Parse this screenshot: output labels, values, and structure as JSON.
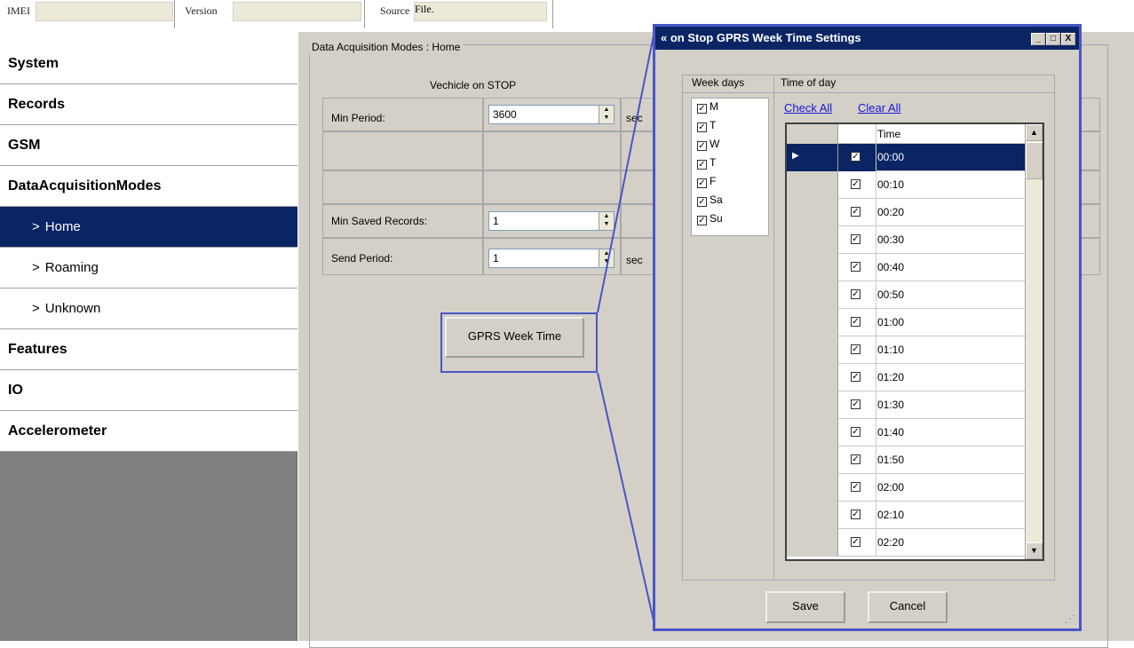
{
  "topbar": {
    "imei_label": "IMEI",
    "version_label": "Version",
    "source_label": "Source",
    "source_value": "File."
  },
  "sidebar": {
    "items": [
      {
        "label": "System",
        "level": "top",
        "active": false
      },
      {
        "label": "Records",
        "level": "top",
        "active": false
      },
      {
        "label": "GSM",
        "level": "top",
        "active": false
      },
      {
        "label": "DataAcquisitionModes",
        "level": "top",
        "active": false
      },
      {
        "label": "Home",
        "level": "sub",
        "active": true
      },
      {
        "label": "Roaming",
        "level": "sub",
        "active": false
      },
      {
        "label": "Unknown",
        "level": "sub",
        "active": false
      },
      {
        "label": "Features",
        "level": "top",
        "active": false
      },
      {
        "label": "IO",
        "level": "top",
        "active": false
      },
      {
        "label": "Accelerometer",
        "level": "top",
        "active": false
      }
    ],
    "chevron": ">"
  },
  "main": {
    "group_title": "Data Acquisition Modes : Home",
    "section_title": "Vechicle on STOP",
    "min_period": {
      "label": "Min Period:",
      "value": "3600",
      "unit": "sec"
    },
    "min_saved_records": {
      "label": "Min Saved Records:",
      "value": "1"
    },
    "send_period": {
      "label": "Send Period:",
      "value": "1",
      "unit": "sec"
    },
    "gprs_button": "GPRS Week Time"
  },
  "dialog": {
    "title": "on Stop GPRS Week Time Settings",
    "title_buttons": [
      "_",
      "□",
      "X"
    ],
    "week_days_header": "Week days",
    "time_of_day_header": "Time of day",
    "check_all": "Check All",
    "clear_all": "Clear All",
    "week_days": [
      {
        "label": "M",
        "checked": true
      },
      {
        "label": "T",
        "checked": true
      },
      {
        "label": "W",
        "checked": true
      },
      {
        "label": "T",
        "checked": true
      },
      {
        "label": "F",
        "checked": true
      },
      {
        "label": "Sa",
        "checked": true
      },
      {
        "label": "Su",
        "checked": true
      }
    ],
    "time_column_header": "Time",
    "times": [
      {
        "time": "00:00",
        "checked": true,
        "selected": true
      },
      {
        "time": "00:10",
        "checked": true,
        "selected": false
      },
      {
        "time": "00:20",
        "checked": true,
        "selected": false
      },
      {
        "time": "00:30",
        "checked": true,
        "selected": false
      },
      {
        "time": "00:40",
        "checked": true,
        "selected": false
      },
      {
        "time": "00:50",
        "checked": true,
        "selected": false
      },
      {
        "time": "01:00",
        "checked": true,
        "selected": false
      },
      {
        "time": "01:10",
        "checked": true,
        "selected": false
      },
      {
        "time": "01:20",
        "checked": true,
        "selected": false
      },
      {
        "time": "01:30",
        "checked": true,
        "selected": false
      },
      {
        "time": "01:40",
        "checked": true,
        "selected": false
      },
      {
        "time": "01:50",
        "checked": true,
        "selected": false
      },
      {
        "time": "02:00",
        "checked": true,
        "selected": false
      },
      {
        "time": "02:10",
        "checked": true,
        "selected": false
      },
      {
        "time": "02:20",
        "checked": true,
        "selected": false
      }
    ],
    "save_label": "Save",
    "cancel_label": "Cancel"
  },
  "colors": {
    "selection": "#0b2463",
    "highlight": "#4a55c6",
    "panel": "#d4d0c8",
    "link": "#1515d8"
  }
}
